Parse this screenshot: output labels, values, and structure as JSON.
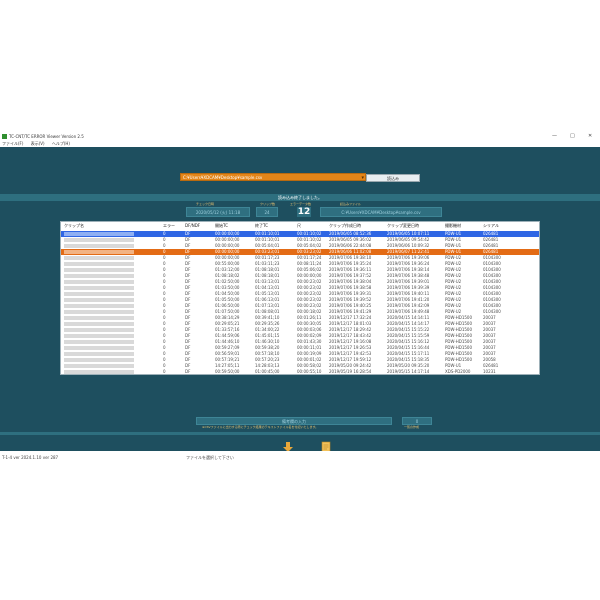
{
  "window": {
    "title": "TC-CNT/TC ERROR Viewer Version 2.5",
    "controls": [
      "—",
      "□",
      "✕"
    ]
  },
  "menu": [
    "ファイル(F)",
    "表示(V)",
    "ヘルプ(H)"
  ],
  "file_selector": {
    "value": "C:¥Users¥XDCAM¥Desktop¥sample.csv",
    "dropdown_icon": "chevron-down-icon"
  },
  "read_button": {
    "label": "読込み"
  },
  "loaded_message": "読み込み終了しました。",
  "summary": {
    "check_datetime": {
      "caption": "チェック日時",
      "value": "2020/05/12  (火)  11:18"
    },
    "clip_count": {
      "caption": "クリップ数",
      "value": "24"
    },
    "error_count": {
      "caption": "エラーデータ数",
      "value": "12"
    },
    "read_file": {
      "caption": "読込みファイル",
      "value": "C:¥Users¥XDCAM¥Desktop¥sample.csv"
    }
  },
  "table": {
    "columns": [
      "クリップ名",
      "エラー",
      "DF/NDF",
      "開始TC",
      "終了TC",
      "尺",
      "クリップ作成日時",
      "クリップ変更日時",
      "撮影機材",
      "シリアル"
    ],
    "rows": [
      {
        "error": "0",
        "df": "DF",
        "start": "00:00:00;00",
        "end": "00:01:10;01",
        "dur": "00:01:10;02",
        "created": "2019/06/05 08:52:36",
        "modified": "2019/06/05 10:07:11",
        "device": "PDW-U1",
        "serial": "026481",
        "state": "sel"
      },
      {
        "error": "0",
        "df": "DF",
        "start": "00:00:00;00",
        "end": "00:01:10;01",
        "dur": "00:01:10;02",
        "created": "2019/06/05 09:36:02",
        "modified": "2019/06/05 09:54:42",
        "device": "PDW-U1",
        "serial": "026481",
        "state": ""
      },
      {
        "error": "0",
        "df": "DF",
        "start": "00:00:00;00",
        "end": "00:05:04;01",
        "dur": "00:05:04;02",
        "created": "2019/06/06 22:44:08",
        "modified": "2019/06/06 10:09:32",
        "device": "PDW-U1",
        "serial": "026481",
        "state": ""
      },
      {
        "error": "0",
        "df": "DF",
        "start": "00:00:00;00",
        "end": "00:03:23;01",
        "dur": "00:03:23;02",
        "created": "2019/06/06 11:02:08",
        "modified": "2019/06/07 11:22:41",
        "device": "PDW-U1",
        "serial": "026481",
        "state": "hl"
      },
      {
        "error": "0",
        "df": "DF",
        "start": "00:00:00;00",
        "end": "00:01:17;23",
        "dur": "00:01:17;24",
        "created": "2019/07/06 19:38:10",
        "modified": "2019/07/06 19:39:06",
        "device": "PDW-U2",
        "serial": "0104300",
        "state": ""
      },
      {
        "error": "0",
        "df": "DF",
        "start": "00:55:00;00",
        "end": "01:03:11;23",
        "dur": "00:08:11;24",
        "created": "2019/07/06 19:35:24",
        "modified": "2019/07/06 19:36:24",
        "device": "PDW-U2",
        "serial": "0104300",
        "state": ""
      },
      {
        "error": "0",
        "df": "DF",
        "start": "01:03:12;00",
        "end": "01:08:18;01",
        "dur": "00:05:06;02",
        "created": "2019/07/06 19:36:11",
        "modified": "2019/07/06 19:38:14",
        "device": "PDW-U2",
        "serial": "0104300",
        "state": ""
      },
      {
        "error": "0",
        "df": "DF",
        "start": "01:08:18;02",
        "end": "01:08:18;01",
        "dur": "00:00:00;00",
        "created": "2019/07/06 19:37:52",
        "modified": "2019/07/06 19:38:48",
        "device": "PDW-U2",
        "serial": "0104300",
        "state": ""
      },
      {
        "error": "0",
        "df": "DF",
        "start": "01:02:50;00",
        "end": "01:03:13;01",
        "dur": "00:00:23;02",
        "created": "2019/07/06 19:38:04",
        "modified": "2019/07/06 19:39:01",
        "device": "PDW-U2",
        "serial": "0104300",
        "state": ""
      },
      {
        "error": "0",
        "df": "DF",
        "start": "01:03:50;00",
        "end": "01:04:13;01",
        "dur": "00:00:23;02",
        "created": "2019/07/06 19:38:58",
        "modified": "2019/07/06 19:39:39",
        "device": "PDW-U2",
        "serial": "0104300",
        "state": ""
      },
      {
        "error": "0",
        "df": "DF",
        "start": "01:04:50;00",
        "end": "01:05:13;01",
        "dur": "00:00:23;02",
        "created": "2019/07/06 19:39:31",
        "modified": "2019/07/06 19:40:11",
        "device": "PDW-U2",
        "serial": "0104300",
        "state": ""
      },
      {
        "error": "0",
        "df": "DF",
        "start": "01:05:50;00",
        "end": "01:06:13;01",
        "dur": "00:00:23;02",
        "created": "2019/07/06 19:39:52",
        "modified": "2019/07/06 19:41:20",
        "device": "PDW-U2",
        "serial": "0104300",
        "state": ""
      },
      {
        "error": "0",
        "df": "DF",
        "start": "01:06:50;00",
        "end": "01:07:13;01",
        "dur": "00:00:23;02",
        "created": "2019/07/06 19:40:25",
        "modified": "2019/07/06 19:42:09",
        "device": "PDW-U2",
        "serial": "0104300",
        "state": ""
      },
      {
        "error": "0",
        "df": "DF",
        "start": "01:07:50;00",
        "end": "01:08:08;01",
        "dur": "00:00:18;02",
        "created": "2019/07/06 19:41:29",
        "modified": "2019/07/06 19:49:48",
        "device": "PDW-U2",
        "serial": "0104300",
        "state": ""
      },
      {
        "error": "0",
        "df": "DF",
        "start": "00:38:14;29",
        "end": "00:39:41;10",
        "dur": "00:01:26;11",
        "created": "2019/12/17 17:32:24",
        "modified": "2020/04/15 14:14:11",
        "device": "PDW-HD1500",
        "serial": "20037",
        "state": ""
      },
      {
        "error": "0",
        "df": "DF",
        "start": "00:29:05;21",
        "end": "00:29:35;26",
        "dur": "00:00:30;05",
        "created": "2019/12/17 18:01:03",
        "modified": "2020/04/15 14:14:17",
        "device": "PDW-HD1500",
        "serial": "20037",
        "state": ""
      },
      {
        "error": "0",
        "df": "DF",
        "start": "01:33:57;16",
        "end": "01:34:00;22",
        "dur": "00:00:03;06",
        "created": "2019/12/17 18:29:42",
        "modified": "2020/04/15 15:15:22",
        "device": "PDW-HD1500",
        "serial": "20037",
        "state": ""
      },
      {
        "error": "0",
        "df": "DF",
        "start": "01:44:59;06",
        "end": "01:45:01;15",
        "dur": "00:00:02;09",
        "created": "2019/12/17 18:43:42",
        "modified": "2020/04/15 15:15:59",
        "device": "PDW-HD1500",
        "serial": "20037",
        "state": ""
      },
      {
        "error": "0",
        "df": "DF",
        "start": "01:44:46;10",
        "end": "01:46:30;10",
        "dur": "00:01:43;30",
        "created": "2019/12/17 19:16:08",
        "modified": "2020/04/15 15:16:12",
        "device": "PDW-HD1500",
        "serial": "20037",
        "state": ""
      },
      {
        "error": "0",
        "df": "DF",
        "start": "00:59:27;09",
        "end": "00:59:38;20",
        "dur": "00:00:11;01",
        "created": "2019/12/17 19:26:53",
        "modified": "2020/04/15 15:16:44",
        "device": "PDW-HD1500",
        "serial": "20037",
        "state": ""
      },
      {
        "error": "0",
        "df": "DF",
        "start": "00:56:59;01",
        "end": "00:57:18;10",
        "dur": "00:00:19;09",
        "created": "2019/12/17 19:42:53",
        "modified": "2020/04/15 15:17:11",
        "device": "PDW-HD1500",
        "serial": "20037",
        "state": ""
      },
      {
        "error": "0",
        "df": "DF",
        "start": "00:57:19;21",
        "end": "00:57:20;23",
        "dur": "00:00:01;02",
        "created": "2019/12/17 19:59:12",
        "modified": "2020/04/15 15:18:35",
        "device": "PDW-HD1500",
        "serial": "20058",
        "state": ""
      },
      {
        "error": "0",
        "df": "DF",
        "start": "14:27:05;11",
        "end": "14:28:03;13",
        "dur": "00:00:58;02",
        "created": "2019/05/20 09:24:42",
        "modified": "2019/05/20 09:35:20",
        "device": "PDW-U1",
        "serial": "026481",
        "state": ""
      },
      {
        "error": "0",
        "df": "DF",
        "start": "00:59:50;00",
        "end": "01:00:45;00",
        "dur": "00:00:55;10",
        "created": "2019/05/19 16:28:54",
        "modified": "2019/05/15 14:17:14",
        "device": "XDS-PD2000",
        "serial": "10231",
        "state": ""
      }
    ]
  },
  "remarks": {
    "value": "備考欄の入力",
    "caption": "※CSVファイルに出力する際にチェック結果のテキストファイル名を付記いたします。",
    "side_value": "0",
    "side_caption": "一覧の作成"
  },
  "actions": {
    "export_icon": "download-arrow-icon",
    "open_icon": "document-icon"
  },
  "status": {
    "left": "T-1-4 ver 2024.1.10 ver 287",
    "middle": "ファイルを選択して下さい"
  },
  "colors": {
    "main_bg": "#1e4f5f",
    "accent_orange": "#e36b15",
    "selection_blue": "#2f66e4",
    "caption_gold": "#e7c271"
  }
}
